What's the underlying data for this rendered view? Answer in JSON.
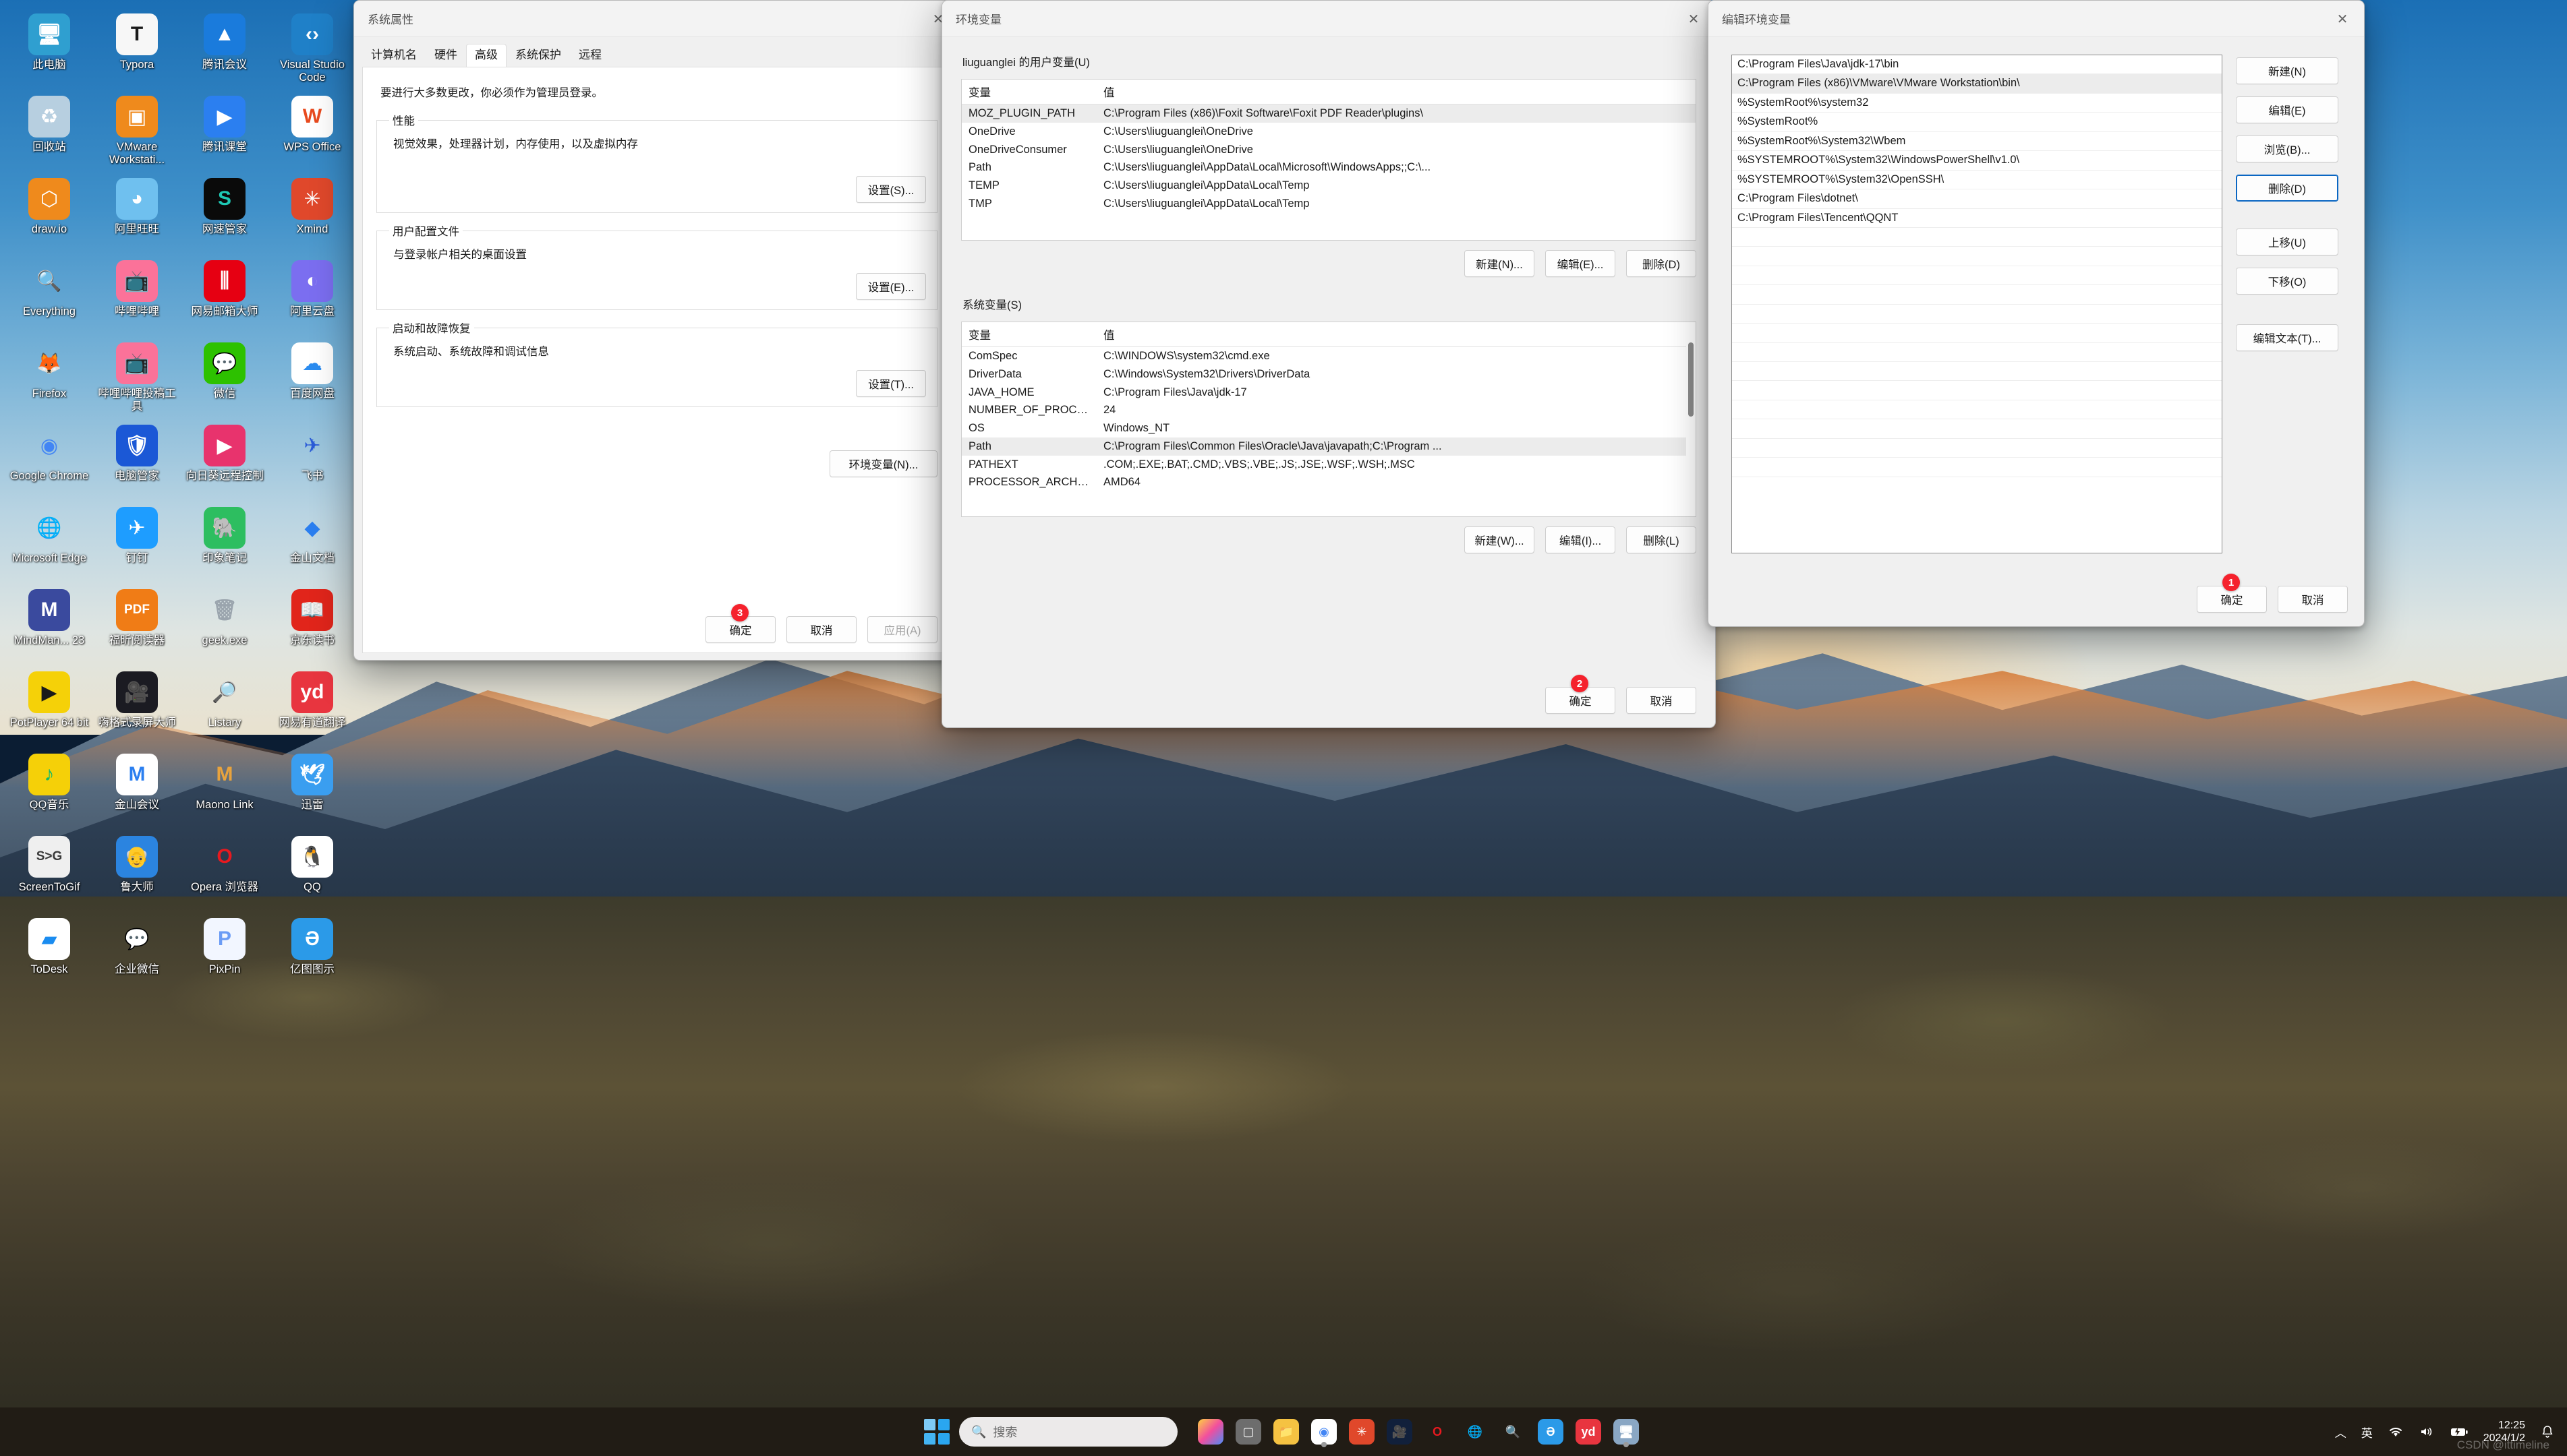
{
  "desktop": {
    "icons": [
      {
        "label": "此电脑",
        "icon": "this-pc-icon",
        "bg": "#2f9fd0",
        "fg": "#ffffff",
        "glyph": "🖥"
      },
      {
        "label": "Typora",
        "icon": "typora-icon",
        "bg": "#f7f7f7",
        "fg": "#1a1a1a",
        "glyph": "T"
      },
      {
        "label": "腾讯会议",
        "icon": "tencent-meeting-icon",
        "bg": "#1a7bdc",
        "fg": "#ffffff",
        "glyph": "▲"
      },
      {
        "label": "Visual Studio Code",
        "icon": "vscode-icon",
        "bg": "#1f80c8",
        "fg": "#ffffff",
        "glyph": "‹›"
      },
      {
        "label": "回收站",
        "icon": "recycle-bin-icon",
        "bg": "#b7cfe0",
        "fg": "#ffffff",
        "glyph": "♻"
      },
      {
        "label": "VMware Workstati...",
        "icon": "vmware-icon",
        "bg": "#ef8a1c",
        "fg": "#ffffff",
        "glyph": "▣"
      },
      {
        "label": "腾讯课堂",
        "icon": "tencent-classroom-icon",
        "bg": "#2b7ff0",
        "fg": "#ffffff",
        "glyph": "▶"
      },
      {
        "label": "WPS Office",
        "icon": "wps-office-icon",
        "bg": "#ffffff",
        "fg": "#e84a1e",
        "glyph": "W"
      },
      {
        "label": "draw.io",
        "icon": "drawio-icon",
        "bg": "#ef8a1c",
        "fg": "#ffffff",
        "glyph": "⬡"
      },
      {
        "label": "阿里旺旺",
        "icon": "aliwangwang-icon",
        "bg": "#6fc0ef",
        "fg": "#ffffff",
        "glyph": "◕"
      },
      {
        "label": "网速管家",
        "icon": "netspeed-manager-icon",
        "bg": "#0a0a0a",
        "fg": "#1ec9b5",
        "glyph": "S"
      },
      {
        "label": "Xmind",
        "icon": "xmind-icon",
        "bg": "#e0482b",
        "fg": "#ffffff",
        "glyph": "✳"
      },
      {
        "label": "Everything",
        "icon": "everything-icon",
        "bg": "transparent",
        "fg": "#f08b1d",
        "glyph": "🔍"
      },
      {
        "label": "哔哩哔哩",
        "icon": "bilibili-icon",
        "bg": "#fb7299",
        "fg": "#ffffff",
        "glyph": "📺"
      },
      {
        "label": "网易邮箱大师",
        "icon": "netease-mail-icon",
        "bg": "#e60012",
        "fg": "#ffffff",
        "glyph": "⫼"
      },
      {
        "label": "阿里云盘",
        "icon": "aliyun-drive-icon",
        "bg": "#7b6ef0",
        "fg": "#ffffff",
        "glyph": "◐"
      },
      {
        "label": "Firefox",
        "icon": "firefox-icon",
        "bg": "transparent",
        "fg": "#ff7139",
        "glyph": "🦊"
      },
      {
        "label": "哔哩哔哩投稿工具",
        "icon": "bilibili-upload-icon",
        "bg": "#fb7299",
        "fg": "#ffffff",
        "glyph": "📺"
      },
      {
        "label": "微信",
        "icon": "wechat-icon",
        "bg": "#2dc100",
        "fg": "#ffffff",
        "glyph": "💬"
      },
      {
        "label": "百度网盘",
        "icon": "baidu-netdisk-icon",
        "bg": "#ffffff",
        "fg": "#2b8cf0",
        "glyph": "☁"
      },
      {
        "label": "Google Chrome",
        "icon": "chrome-icon",
        "bg": "transparent",
        "fg": "#4285f4",
        "glyph": "◉"
      },
      {
        "label": "电脑管家",
        "icon": "pc-manager-icon",
        "bg": "#1b58d6",
        "fg": "#ffffff",
        "glyph": "🛡"
      },
      {
        "label": "向日葵远程控制",
        "icon": "sunflower-remote-icon",
        "bg": "#e8336d",
        "fg": "#ffffff",
        "glyph": "▶"
      },
      {
        "label": "飞书",
        "icon": "feishu-icon",
        "bg": "transparent",
        "fg": "#2b5bd7",
        "glyph": "✈"
      },
      {
        "label": "Microsoft Edge",
        "icon": "edge-icon",
        "bg": "transparent",
        "fg": "#1f9ed8",
        "glyph": "🌐"
      },
      {
        "label": "钉钉",
        "icon": "dingtalk-icon",
        "bg": "#1e9dff",
        "fg": "#ffffff",
        "glyph": "✈"
      },
      {
        "label": "印象笔记",
        "icon": "evernote-icon",
        "bg": "#2dbe60",
        "fg": "#1a1a1a",
        "glyph": "🐘"
      },
      {
        "label": "金山文档",
        "icon": "kingsoft-docs-icon",
        "bg": "transparent",
        "fg": "#2b7ff0",
        "glyph": "◆"
      },
      {
        "label": "MindMan... 23",
        "icon": "mindmanager-icon",
        "bg": "#3a4a9e",
        "fg": "#ffffff",
        "glyph": "M"
      },
      {
        "label": "福昕阅读器",
        "icon": "foxit-reader-icon",
        "bg": "#f07c16",
        "fg": "#ffffff",
        "glyph": "PDF"
      },
      {
        "label": "geek.exe",
        "icon": "geek-uninstaller-icon",
        "bg": "transparent",
        "fg": "#9aa4ad",
        "glyph": "🗑"
      },
      {
        "label": "京东读书",
        "icon": "jd-read-icon",
        "bg": "#e1251b",
        "fg": "#ffffff",
        "glyph": "📖"
      },
      {
        "label": "PotPlayer 64 bit",
        "icon": "potplayer-icon",
        "bg": "#f5d108",
        "fg": "#1a1a1a",
        "glyph": "▶"
      },
      {
        "label": "嗨格式录屏大师",
        "icon": "higeshi-recorder-icon",
        "bg": "#1b1b22",
        "fg": "#ffffff",
        "glyph": "🎥"
      },
      {
        "label": "Listary",
        "icon": "listary-icon",
        "bg": "transparent",
        "fg": "#3aa0e8",
        "glyph": "🔎"
      },
      {
        "label": "网易有道翻译",
        "icon": "youdao-translate-icon",
        "bg": "#e8353f",
        "fg": "#ffffff",
        "glyph": "yd"
      },
      {
        "label": "QQ音乐",
        "icon": "qq-music-icon",
        "bg": "#f5d008",
        "fg": "#0fb96a",
        "glyph": "♪"
      },
      {
        "label": "金山会议",
        "icon": "kingsoft-meeting-icon",
        "bg": "#ffffff",
        "fg": "#2b7ff0",
        "glyph": "M"
      },
      {
        "label": "Maono Link",
        "icon": "maono-link-icon",
        "bg": "transparent",
        "fg": "#e8a33d",
        "glyph": "M"
      },
      {
        "label": "迅雷",
        "icon": "thunder-icon",
        "bg": "#3a9ef0",
        "fg": "#ffffff",
        "glyph": "🕊"
      },
      {
        "label": "ScreenToGif",
        "icon": "screentogif-icon",
        "bg": "#efefef",
        "fg": "#3a3a3a",
        "glyph": "S>G"
      },
      {
        "label": "鲁大师",
        "icon": "ludashi-icon",
        "bg": "#2b84e0",
        "fg": "#ffffff",
        "glyph": "👴"
      },
      {
        "label": "Opera 浏览器",
        "icon": "opera-icon",
        "bg": "transparent",
        "fg": "#e8191f",
        "glyph": "O"
      },
      {
        "label": "QQ",
        "icon": "qq-icon",
        "bg": "#ffffff",
        "fg": "#1a1a1a",
        "glyph": "🐧"
      },
      {
        "label": "ToDesk",
        "icon": "todesk-icon",
        "bg": "#ffffff",
        "fg": "#1a8cf0",
        "glyph": "▰"
      },
      {
        "label": "企业微信",
        "icon": "wecom-icon",
        "bg": "transparent",
        "fg": "#2b9ae8",
        "glyph": "💬"
      },
      {
        "label": "PixPin",
        "icon": "pixpin-icon",
        "bg": "#f2f6ff",
        "fg": "#6b9cf5",
        "glyph": "P"
      },
      {
        "label": "亿图图示",
        "icon": "edraw-icon",
        "bg": "#2b9ae8",
        "fg": "#ffffff",
        "glyph": "Ə"
      }
    ]
  },
  "system_properties": {
    "title": "系统属性",
    "close": "✕",
    "tabs": [
      {
        "label": "计算机名",
        "active": false
      },
      {
        "label": "硬件",
        "active": false
      },
      {
        "label": "高级",
        "active": true
      },
      {
        "label": "系统保护",
        "active": false
      },
      {
        "label": "远程",
        "active": false
      }
    ],
    "hint": "要进行大多数更改，你必须作为管理员登录。",
    "groups": [
      {
        "legend": "性能",
        "desc": "视觉效果，处理器计划，内存使用，以及虚拟内存",
        "button": "设置(S)..."
      },
      {
        "legend": "用户配置文件",
        "desc": "与登录帐户相关的桌面设置",
        "button": "设置(E)..."
      },
      {
        "legend": "启动和故障恢复",
        "desc": "系统启动、系统故障和调试信息",
        "button": "设置(T)..."
      }
    ],
    "env_button": "环境变量(N)...",
    "ok": "确定",
    "cancel": "取消",
    "apply": "应用(A)",
    "badge": "3"
  },
  "environment_variables": {
    "title": "环境变量",
    "close": "✕",
    "user_section": {
      "legend": "liuguanglei 的用户变量(U)",
      "columns": [
        "变量",
        "值"
      ],
      "rows": [
        {
          "variable": "MOZ_PLUGIN_PATH",
          "value": "C:\\Program Files (x86)\\Foxit Software\\Foxit PDF Reader\\plugins\\",
          "selected": true
        },
        {
          "variable": "OneDrive",
          "value": "C:\\Users\\liuguanglei\\OneDrive",
          "selected": false
        },
        {
          "variable": "OneDriveConsumer",
          "value": "C:\\Users\\liuguanglei\\OneDrive",
          "selected": false
        },
        {
          "variable": "Path",
          "value": "C:\\Users\\liuguanglei\\AppData\\Local\\Microsoft\\WindowsApps;;C:\\...",
          "selected": false
        },
        {
          "variable": "TEMP",
          "value": "C:\\Users\\liuguanglei\\AppData\\Local\\Temp",
          "selected": false
        },
        {
          "variable": "TMP",
          "value": "C:\\Users\\liuguanglei\\AppData\\Local\\Temp",
          "selected": false
        }
      ],
      "new_button": "新建(N)...",
      "edit_button": "编辑(E)...",
      "delete_button": "删除(D)"
    },
    "system_section": {
      "legend": "系统变量(S)",
      "columns": [
        "变量",
        "值"
      ],
      "rows": [
        {
          "variable": "ComSpec",
          "value": "C:\\WINDOWS\\system32\\cmd.exe",
          "selected": false
        },
        {
          "variable": "DriverData",
          "value": "C:\\Windows\\System32\\Drivers\\DriverData",
          "selected": false
        },
        {
          "variable": "JAVA_HOME",
          "value": "C:\\Program Files\\Java\\jdk-17",
          "selected": false
        },
        {
          "variable": "NUMBER_OF_PROCESSORS",
          "value": "24",
          "selected": false
        },
        {
          "variable": "OS",
          "value": "Windows_NT",
          "selected": false
        },
        {
          "variable": "Path",
          "value": "C:\\Program Files\\Common Files\\Oracle\\Java\\javapath;C:\\Program ...",
          "selected": true
        },
        {
          "variable": "PATHEXT",
          "value": ".COM;.EXE;.BAT;.CMD;.VBS;.VBE;.JS;.JSE;.WSF;.WSH;.MSC",
          "selected": false
        },
        {
          "variable": "PROCESSOR_ARCHITECTURE",
          "value": "AMD64",
          "selected": false
        }
      ],
      "new_button": "新建(W)...",
      "edit_button": "编辑(I)...",
      "delete_button": "删除(L)"
    },
    "ok": "确定",
    "cancel": "取消",
    "badge": "2"
  },
  "edit_environment_variable": {
    "title": "编辑环境变量",
    "close": "✕",
    "paths": [
      {
        "value": "C:\\Program Files\\Java\\jdk-17\\bin",
        "selected": false
      },
      {
        "value": "C:\\Program Files (x86)\\VMware\\VMware Workstation\\bin\\",
        "selected": true
      },
      {
        "value": "%SystemRoot%\\system32",
        "selected": false
      },
      {
        "value": "%SystemRoot%",
        "selected": false
      },
      {
        "value": "%SystemRoot%\\System32\\Wbem",
        "selected": false
      },
      {
        "value": "%SYSTEMROOT%\\System32\\WindowsPowerShell\\v1.0\\",
        "selected": false
      },
      {
        "value": "%SYSTEMROOT%\\System32\\OpenSSH\\",
        "selected": false
      },
      {
        "value": "C:\\Program Files\\dotnet\\",
        "selected": false
      },
      {
        "value": "C:\\Program Files\\Tencent\\QQNT",
        "selected": false
      }
    ],
    "empty_rows": 13,
    "buttons": {
      "new": "新建(N)",
      "edit": "编辑(E)",
      "browse": "浏览(B)...",
      "delete": "删除(D)",
      "move_up": "上移(U)",
      "move_down": "下移(O)",
      "edit_text": "编辑文本(T)..."
    },
    "ok": "确定",
    "cancel": "取消",
    "badge": "1"
  },
  "taskbar": {
    "start": "start-button",
    "search_placeholder": "搜索",
    "apps": [
      {
        "name": "copilot-pre-icon",
        "bg": "linear-gradient(135deg,#ffd23f,#f24e9e,#4b8df8)",
        "fg": "#ffffff",
        "glyph": ""
      },
      {
        "name": "task-view-icon",
        "bg": "#6d6d6d",
        "fg": "#ffffff",
        "glyph": "▢"
      },
      {
        "name": "file-explorer-icon",
        "bg": "#f5c242",
        "fg": "#ffffff",
        "glyph": "📁"
      },
      {
        "name": "chrome-icon",
        "bg": "#ffffff",
        "fg": "#4285f4",
        "glyph": "◉",
        "active": true
      },
      {
        "name": "xmind-icon",
        "bg": "#e0482b",
        "fg": "#ffffff",
        "glyph": "✳"
      },
      {
        "name": "tencent-meeting-icon",
        "bg": "#11203b",
        "fg": "#ffffff",
        "glyph": "🎥"
      },
      {
        "name": "opera-icon",
        "bg": "transparent",
        "fg": "#e8191f",
        "glyph": "O"
      },
      {
        "name": "edge-icon",
        "bg": "transparent",
        "fg": "#1f9ed8",
        "glyph": "🌐"
      },
      {
        "name": "everything-icon",
        "bg": "transparent",
        "fg": "#f08b1d",
        "glyph": "🔍"
      },
      {
        "name": "edraw-icon",
        "bg": "#2b9ae8",
        "fg": "#ffffff",
        "glyph": "Ə"
      },
      {
        "name": "youdao-translate-icon",
        "bg": "#e8353f",
        "fg": "#ffffff",
        "glyph": "yd"
      },
      {
        "name": "system-properties-icon",
        "bg": "#8aa7c4",
        "fg": "#ffffff",
        "glyph": "🖥",
        "active": true
      }
    ],
    "tray": {
      "chevron": "︿",
      "ime": "英",
      "wifi": "wifi-icon",
      "volume": "volume-icon",
      "battery": "battery-icon",
      "time": "12:25",
      "date": "2024/1/2",
      "notifications": "bell-icon"
    },
    "watermark": "CSDN @ittimeline"
  }
}
